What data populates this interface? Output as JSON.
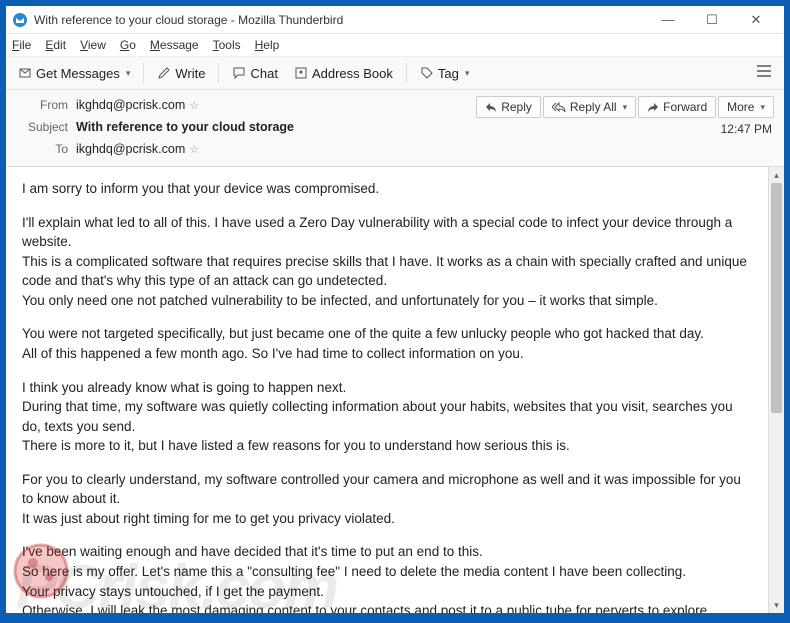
{
  "window": {
    "title": "With reference to your cloud storage - Mozilla Thunderbird"
  },
  "menu": {
    "file": "File",
    "edit": "Edit",
    "view": "View",
    "go": "Go",
    "message": "Message",
    "tools": "Tools",
    "help": "Help"
  },
  "toolbar": {
    "get_messages": "Get Messages",
    "write": "Write",
    "chat": "Chat",
    "address_book": "Address Book",
    "tag": "Tag"
  },
  "headers": {
    "from_label": "From",
    "from_value": "ikghdq@pcrisk.com",
    "subject_label": "Subject",
    "subject_value": "With reference to your cloud storage",
    "to_label": "To",
    "to_value": "ikghdq@pcrisk.com",
    "time": "12:47 PM"
  },
  "actions": {
    "reply": "Reply",
    "reply_all": "Reply All",
    "forward": "Forward",
    "more": "More"
  },
  "body": {
    "p1": "I am sorry to inform you that your device was compromised.",
    "p2": "I'll explain what led to all of this. I have used a Zero Day vulnerability with a special code to infect your device through a website.\nThis is a complicated software that requires precise skills that I have. It works as a chain with specially crafted and unique code and that's why this type of an attack can go undetected.\nYou only need one not patched vulnerability to be infected, and unfortunately for you – it works that simple.",
    "p3": "You were not targeted specifically, but just became one of the quite a few unlucky people who got hacked that day.\nAll of this happened a few month ago. So I've had time to collect information on you.",
    "p4": "I think you already know what is going to happen next.\nDuring that time, my software was quietly collecting information about your habits, websites that you visit, searches you do, texts you send.\nThere is more to it, but I have listed a few reasons for you to understand how serious this is.",
    "p5": "For you to clearly understand, my software controlled your camera and microphone as well and it was impossible for you to know about it.\nIt was just about right timing for me to get you privacy violated.",
    "p6": "I've been waiting enough and have decided that it's time to put an end to this.\nSo here is my offer. Let's name this a \"consulting fee\" I need to delete the media content I have been collecting.\nYour privacy stays untouched, if I get the payment.\nOtherwise, I will leak the most damaging content to your contacts and post it to a public tube for perverts to explore."
  },
  "watermark": "PCrisk.com"
}
